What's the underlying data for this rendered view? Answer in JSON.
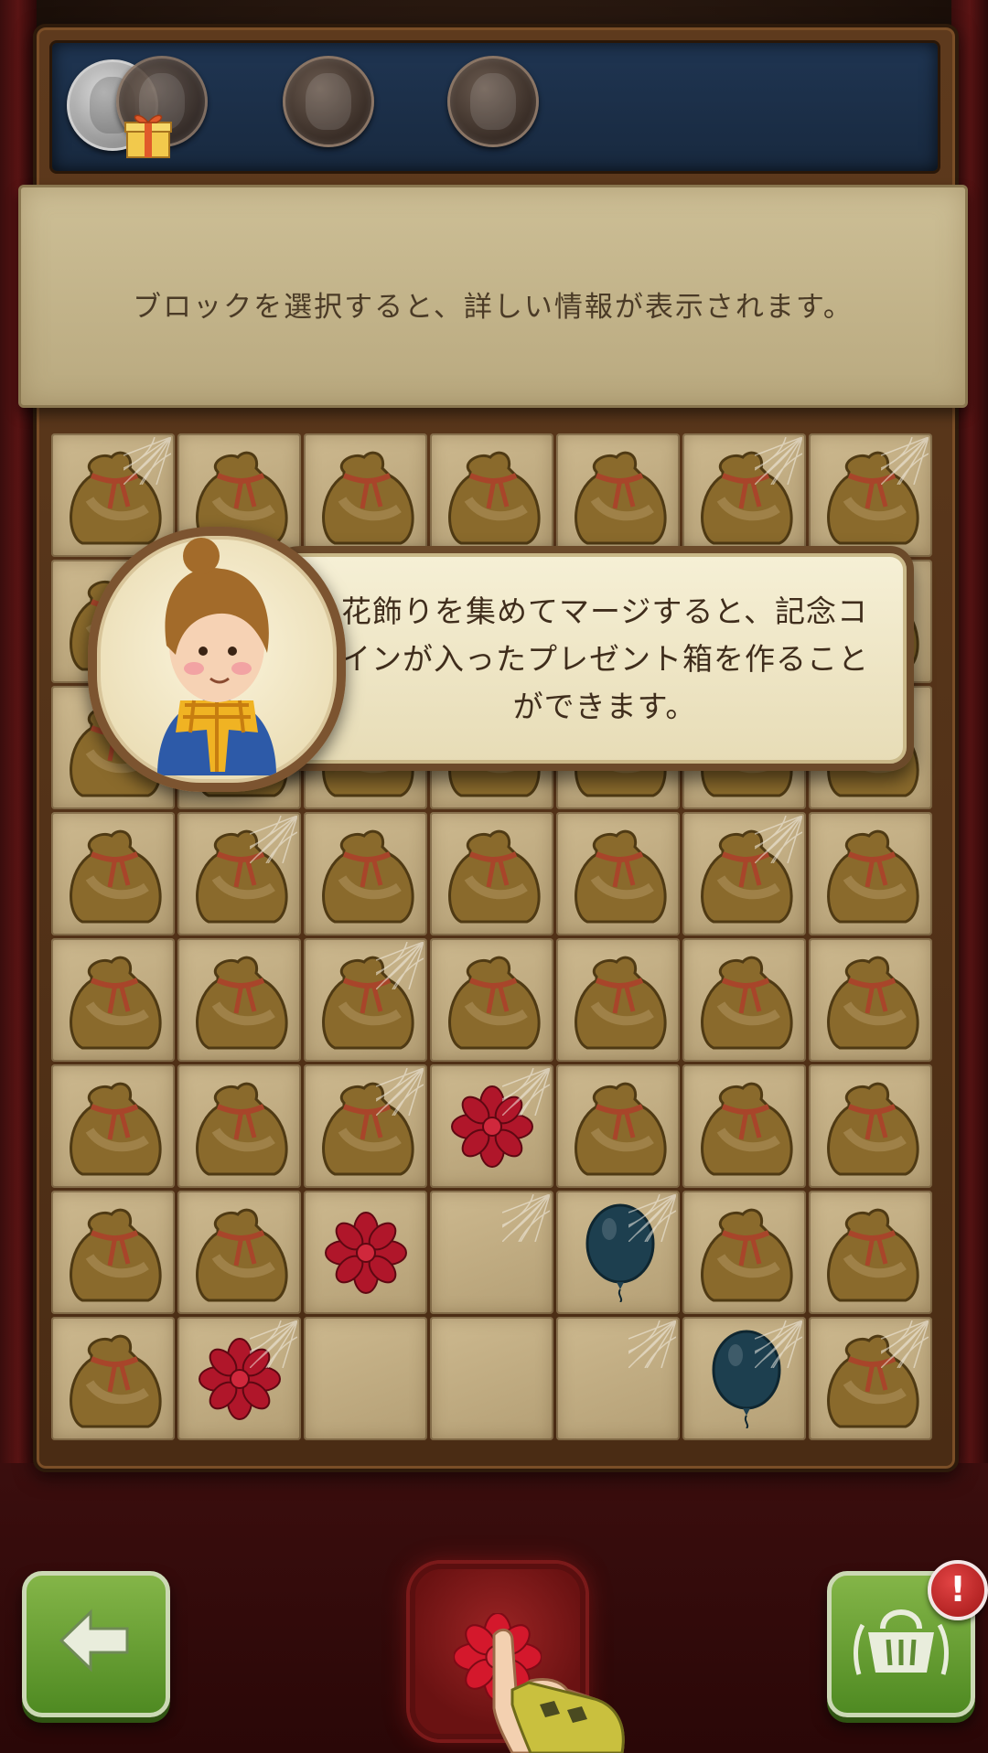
{
  "info_banner": {
    "text": "ブロックを選択すると、詳しい情報が表示されます。"
  },
  "coin_shelf": {
    "coins": [
      {
        "name": "commemorative-coin-1",
        "state": "silver"
      },
      {
        "name": "commemorative-coin-2",
        "state": "bronze"
      },
      {
        "name": "commemorative-coin-3",
        "state": "bronze"
      },
      {
        "name": "commemorative-coin-4",
        "state": "bronze"
      }
    ],
    "gift_icon": "gift-box-icon"
  },
  "dialog": {
    "text": "花飾りを集めてマージすると、記念コインが入ったプレゼント箱を作ることができます。",
    "portrait_icon": "guide-character-portrait"
  },
  "grid": {
    "columns": 7,
    "rows": 8,
    "cells": [
      [
        "bag",
        "bag",
        "bag",
        "bag",
        "bag",
        "bag",
        "bag"
      ],
      [
        "bag",
        "bag",
        "bag",
        "bag",
        "bag",
        "bag",
        "bag"
      ],
      [
        "bag",
        "bag",
        "bag",
        "bag",
        "bag",
        "bag",
        "bag"
      ],
      [
        "bag",
        "bag",
        "bag",
        "bag",
        "bag",
        "bag",
        "bag"
      ],
      [
        "bag",
        "bag",
        "bag",
        "bag",
        "bag",
        "bag",
        "bag"
      ],
      [
        "bag",
        "bag",
        "bag",
        "bow",
        "bag",
        "bag",
        "bag"
      ],
      [
        "bag",
        "bag",
        "bow",
        "empty",
        "balloon",
        "bag",
        "bag"
      ],
      [
        "bag",
        "bow",
        "empty",
        "empty",
        "empty",
        "balloon",
        "bag"
      ]
    ],
    "webbed_cells": [
      [
        0,
        0
      ],
      [
        0,
        5
      ],
      [
        0,
        6
      ],
      [
        3,
        1
      ],
      [
        3,
        5
      ],
      [
        4,
        2
      ],
      [
        5,
        2
      ],
      [
        5,
        3
      ],
      [
        6,
        3
      ],
      [
        6,
        4
      ],
      [
        7,
        1
      ],
      [
        7,
        4
      ],
      [
        7,
        5
      ],
      [
        7,
        6
      ]
    ],
    "colors": {
      "bag": "#8a6a2c",
      "bow": "#b0162a",
      "balloon": "#1d3f4f"
    }
  },
  "bottom_bar": {
    "back_icon": "arrow-left-icon",
    "merge_icon": "red-bow-icon",
    "shop_icon": "basket-icon",
    "alert_badge": "!"
  }
}
